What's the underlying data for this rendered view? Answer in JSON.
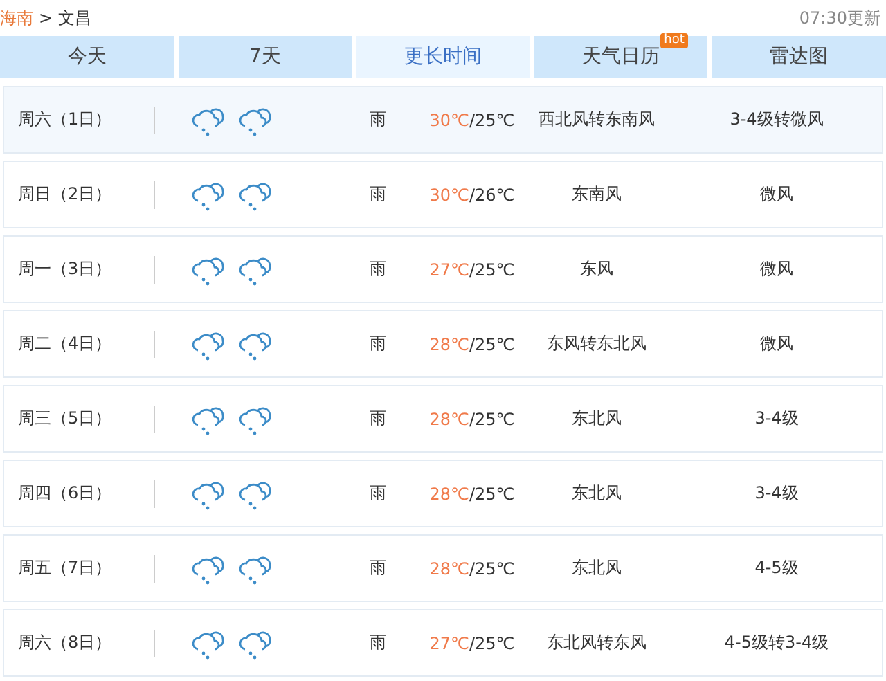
{
  "breadcrumb": {
    "province": "海南",
    "separator": ">",
    "city": "文昌"
  },
  "update_time": "07:30更新",
  "tabs": [
    {
      "label": "今天",
      "selected": false
    },
    {
      "label": "7天",
      "selected": false
    },
    {
      "label": "更长时间",
      "selected": true
    },
    {
      "label": "天气日历",
      "selected": false,
      "badge": "hot"
    },
    {
      "label": "雷达图",
      "selected": false
    }
  ],
  "days": [
    {
      "date": "周六（1日）",
      "weather": "雨",
      "high": "30℃",
      "low": "/25℃",
      "wind_direction": "西北风转东南风",
      "wind_level": "3-4级转微风",
      "highlighted": true
    },
    {
      "date": "周日（2日）",
      "weather": "雨",
      "high": "30℃",
      "low": "/26℃",
      "wind_direction": "东南风",
      "wind_level": "微风",
      "highlighted": false
    },
    {
      "date": "周一（3日）",
      "weather": "雨",
      "high": "27℃",
      "low": "/25℃",
      "wind_direction": "东风",
      "wind_level": "微风",
      "highlighted": false
    },
    {
      "date": "周二（4日）",
      "weather": "雨",
      "high": "28℃",
      "low": "/25℃",
      "wind_direction": "东风转东北风",
      "wind_level": "微风",
      "highlighted": false
    },
    {
      "date": "周三（5日）",
      "weather": "雨",
      "high": "28℃",
      "low": "/25℃",
      "wind_direction": "东北风",
      "wind_level": "3-4级",
      "highlighted": false
    },
    {
      "date": "周四（6日）",
      "weather": "雨",
      "high": "28℃",
      "low": "/25℃",
      "wind_direction": "东北风",
      "wind_level": "3-4级",
      "highlighted": false
    },
    {
      "date": "周五（7日）",
      "weather": "雨",
      "high": "28℃",
      "low": "/25℃",
      "wind_direction": "东北风",
      "wind_level": "4-5级",
      "highlighted": false
    },
    {
      "date": "周六（8日）",
      "weather": "雨",
      "high": "27℃",
      "low": "/25℃",
      "wind_direction": "东北风转东风",
      "wind_level": "4-5级转3-4级",
      "highlighted": false
    }
  ]
}
